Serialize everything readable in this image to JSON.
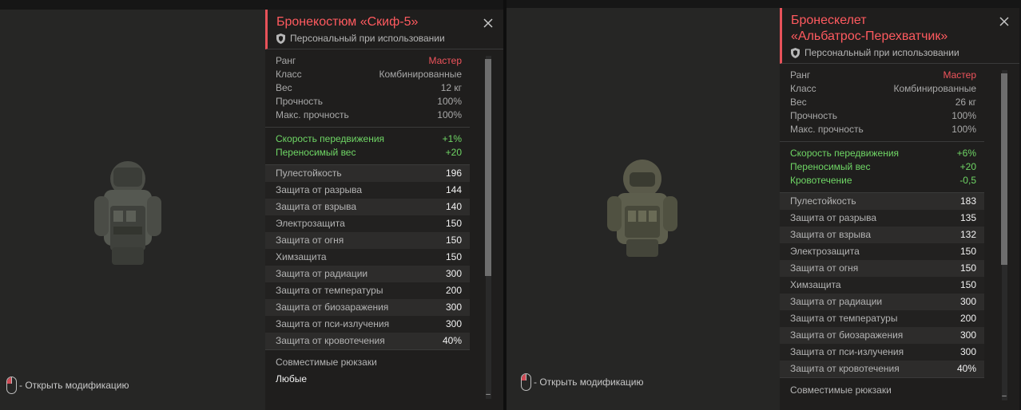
{
  "hint": {
    "label": "- Открыть модификацию"
  },
  "left": {
    "title": "Бронекостюм «Скиф-5»",
    "subtitle": "Персональный при использовании",
    "stats": [
      {
        "k": "Ранг",
        "v": "Мастер"
      },
      {
        "k": "Класс",
        "v": "Комбинированные"
      },
      {
        "k": "Вес",
        "v": "12 кг"
      },
      {
        "k": "Прочность",
        "v": "100%"
      },
      {
        "k": "Макс. прочность",
        "v": "100%"
      }
    ],
    "bonus": [
      {
        "k": "Скорость передвижения",
        "v": "+1%"
      },
      {
        "k": "Переносимый вес",
        "v": "+20"
      }
    ],
    "protection": [
      {
        "k": "Пулестойкость",
        "v": "196"
      },
      {
        "k": "Защита от разрыва",
        "v": "144"
      },
      {
        "k": "Защита от взрыва",
        "v": "140"
      },
      {
        "k": "Электрозащита",
        "v": "150"
      },
      {
        "k": "Защита от огня",
        "v": "150"
      },
      {
        "k": "Химзащита",
        "v": "150"
      },
      {
        "k": "Защита от радиации",
        "v": "300"
      },
      {
        "k": "Защита от температуры",
        "v": "200"
      },
      {
        "k": "Защита от биозаражения",
        "v": "300"
      },
      {
        "k": "Защита от пси-излучения",
        "v": "300"
      },
      {
        "k": "Защита от кровотечения",
        "v": "40%"
      }
    ],
    "compat_label": "Совместимые рюкзаки",
    "compat_value": "Любые"
  },
  "right": {
    "title1": "Бронескелет",
    "title2": "«Альбатрос-Перехватчик»",
    "subtitle": "Персональный при использовании",
    "stats": [
      {
        "k": "Ранг",
        "v": "Мастер"
      },
      {
        "k": "Класс",
        "v": "Комбинированные"
      },
      {
        "k": "Вес",
        "v": "26 кг"
      },
      {
        "k": "Прочность",
        "v": "100%"
      },
      {
        "k": "Макс. прочность",
        "v": "100%"
      }
    ],
    "bonus": [
      {
        "k": "Скорость передвижения",
        "v": "+6%"
      },
      {
        "k": "Переносимый вес",
        "v": "+20"
      },
      {
        "k": "Кровотечение",
        "v": "-0,5"
      }
    ],
    "protection": [
      {
        "k": "Пулестойкость",
        "v": "183"
      },
      {
        "k": "Защита от разрыва",
        "v": "135"
      },
      {
        "k": "Защита от взрыва",
        "v": "132"
      },
      {
        "k": "Электрозащита",
        "v": "150"
      },
      {
        "k": "Защита от огня",
        "v": "150"
      },
      {
        "k": "Химзащита",
        "v": "150"
      },
      {
        "k": "Защита от радиации",
        "v": "300"
      },
      {
        "k": "Защита от температуры",
        "v": "200"
      },
      {
        "k": "Защита от биозаражения",
        "v": "300"
      },
      {
        "k": "Защита от пси-излучения",
        "v": "300"
      },
      {
        "k": "Защита от кровотечения",
        "v": "40%"
      }
    ],
    "compat_label": "Совместимые рюкзаки"
  },
  "colors": {
    "accent": "#ff5a5f",
    "bonus": "#6fd665",
    "rank": "#f0545c"
  }
}
